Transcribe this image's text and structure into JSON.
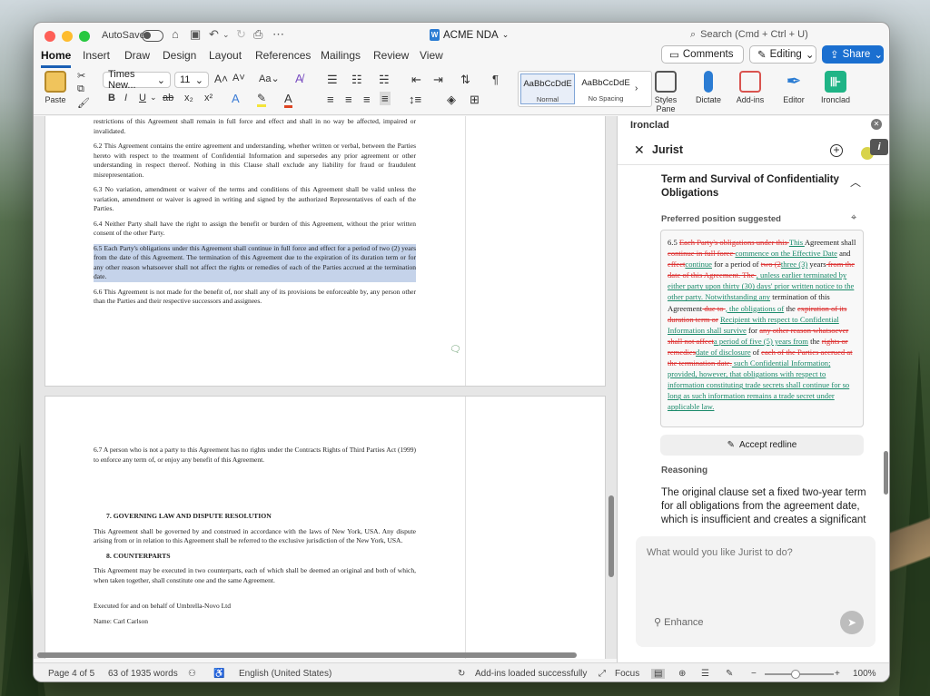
{
  "window": {
    "autosave_label": "AutoSave",
    "doc_title": "ACME NDA",
    "search_placeholder": "Search (Cmd + Ctrl + U)"
  },
  "tabs": [
    "Home",
    "Insert",
    "Draw",
    "Design",
    "Layout",
    "References",
    "Mailings",
    "Review",
    "View"
  ],
  "header_buttons": {
    "comments": "Comments",
    "editing": "Editing",
    "share": "Share"
  },
  "ribbon": {
    "paste": "Paste",
    "font": "Times New...",
    "size": "11",
    "style_normal_preview": "AaBbCcDdE",
    "style_normal": "Normal",
    "style_nospacing_preview": "AaBbCcDdE",
    "style_nospacing": "No Spacing",
    "styles_pane": "Styles Pane",
    "dictate": "Dictate",
    "addins": "Add-ins",
    "editor": "Editor",
    "ironclad": "Ironclad"
  },
  "document": {
    "page1": [
      "restrictions of this Agreement shall remain in full force and effect and shall in no way be affected, impaired or invalidated.",
      "6.2 This Agreement contains the entire agreement and understanding, whether written or verbal, between the Parties hereto with respect to the treatment of Confidential Information and supersedes any prior agreement or other understanding in respect thereof. Nothing in this Clause shall exclude any liability for fraud or fraudulent misrepresentation.",
      "6.3 No variation, amendment or waiver of the terms and conditions of this Agreement shall be valid unless the variation, amendment or waiver is agreed in writing and signed by the authorized Representatives of each of the Parties.",
      "6.4 Neither Party shall have the right to assign the benefit or burden of this Agreement, without the prior written consent of the other Party."
    ],
    "highlighted": "6.5 Each Party's obligations under this Agreement shall continue in full force and effect for a period of two (2) years from the date of this Agreement. The termination of this Agreement due to the expiration of its duration term or for any other reason whatsoever shall not affect the rights or remedies of each of the Parties accrued at the termination date.",
    "p66": "6.6 This Agreement is not made for the benefit of, nor shall any of its provisions be enforceable by, any person other than the Parties and their respective successors and assignees.",
    "p67": "6.7 A person who is not a party to this Agreement has no rights under the Contracts Rights of Third Parties Act (1999) to enforce any term of, or enjoy any benefit of this Agreement.",
    "h7": "7. GOVERNING LAW AND DISPUTE RESOLUTION",
    "p7": "This Agreement shall be governed by and construed in accordance with the laws of New York, USA. Any dispute arising from or in relation to this Agreement shall be referred to the exclusive jurisdiction of the New York, USA.",
    "h8": "8. COUNTERPARTS",
    "p8": "This Agreement may be executed in two counterparts, each of which shall be deemed an original and both of which, when taken together, shall constitute one and the same Agreement.",
    "executed": "Executed for and on behalf of Umbrella-Novo Ltd",
    "name": "Name: Carl Carlson"
  },
  "status": {
    "page": "Page 4 of 5",
    "words": "63 of 1935 words",
    "lang": "English (United States)",
    "addins": "Add-ins loaded successfully",
    "focus": "Focus",
    "zoom": "100%"
  },
  "panel": {
    "title": "Ironclad",
    "assistant": "Jurist",
    "section_title": "Term and Survival of Confidentiality Obligations",
    "preferred": "Preferred position suggested",
    "accept": "Accept redline",
    "reasoning_head": "Reasoning",
    "reasoning": "The original clause set a fixed two-year term for all obligations from the agreement date, which is insufficient and creates a significant risk of exposing confidential information",
    "chat_placeholder": "What would you like Jurist to do?",
    "enhance": "Enhance"
  },
  "redline": [
    {
      "t": "n",
      "s": "6.5 "
    },
    {
      "t": "d",
      "s": "Each Party's obligations under this "
    },
    {
      "t": "i",
      "s": "This "
    },
    {
      "t": "n",
      "s": "Agreement shall "
    },
    {
      "t": "d",
      "s": "continue in full force "
    },
    {
      "t": "i",
      "s": "commence on the Effective Date"
    },
    {
      "t": "n",
      "s": " and "
    },
    {
      "t": "d",
      "s": "effect"
    },
    {
      "t": "i",
      "s": "continue"
    },
    {
      "t": "n",
      "s": " for a period of "
    },
    {
      "t": "d",
      "s": "two (2"
    },
    {
      "t": "i",
      "s": "three (3)"
    },
    {
      "t": "n",
      "s": " years"
    },
    {
      "t": "d",
      "s": " from the date of this Agreement. The "
    },
    {
      "t": "i",
      "s": ", unless earlier terminated by either party upon thirty (30) days' prior written notice to the other party. Notwithstanding any"
    },
    {
      "t": "n",
      "s": " termination of this Agreement"
    },
    {
      "t": "d",
      "s": " due to "
    },
    {
      "t": "i",
      "s": ", the obligations of"
    },
    {
      "t": "n",
      "s": " the "
    },
    {
      "t": "d",
      "s": "expiration of its duration term or"
    },
    {
      "t": "n",
      "s": " "
    },
    {
      "t": "i",
      "s": "Recipient with respect to Confidential Information shall survive"
    },
    {
      "t": "n",
      "s": " for "
    },
    {
      "t": "d",
      "s": "any other reason whatsoever shall not affect"
    },
    {
      "t": "i",
      "s": "a period of five (5) years from"
    },
    {
      "t": "n",
      "s": " the "
    },
    {
      "t": "d",
      "s": "rights or remedies"
    },
    {
      "t": "i",
      "s": "date of disclosure"
    },
    {
      "t": "n",
      "s": " of "
    },
    {
      "t": "d",
      "s": "each of the Parties accrued at the termination date."
    },
    {
      "t": "i",
      "s": " such Confidential Information; provided, however, that obligations with respect to information constituting trade secrets shall continue for so long as such information remains a trade secret under applicable law."
    }
  ]
}
